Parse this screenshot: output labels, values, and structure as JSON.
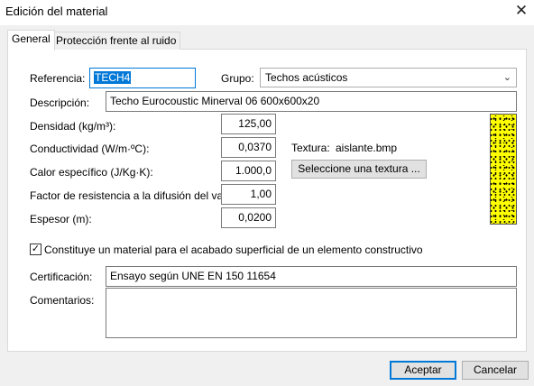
{
  "window": {
    "title": "Edición del material",
    "close_glyph": "✕"
  },
  "tabs": [
    {
      "label": "General",
      "active": true
    },
    {
      "label": "Protección frente al ruido",
      "active": false
    }
  ],
  "form": {
    "referencia": {
      "label": "Referencia:",
      "value": "TECH4"
    },
    "grupo": {
      "label": "Grupo:",
      "value": "Techos acústicos"
    },
    "descripcion": {
      "label": "Descripción:",
      "value": "Techo Eurocoustic Minerval 06 600x600x20"
    },
    "densidad": {
      "label": "Densidad (kg/m³):",
      "value": "125,00"
    },
    "conductividad": {
      "label": "Conductividad (W/m·ºC):",
      "value": "0,0370"
    },
    "calor": {
      "label": "Calor específico (J/Kg·K):",
      "value": "1.000,0"
    },
    "resistencia": {
      "label": "Factor de resistencia a la difusión del vapor:",
      "value": "1,00"
    },
    "espesor": {
      "label": "Espesor (m):",
      "value": "0,0200"
    },
    "textura": {
      "label": "Textura:",
      "value": "aislante.bmp",
      "button": "Seleccione una textura ...",
      "swatch_color": "#ffff00"
    },
    "acabado": {
      "label": "Constituye un material para el acabado superficial de un elemento constructivo",
      "checked": true,
      "check_glyph": "✓"
    },
    "certificacion": {
      "label": "Certificación:",
      "value": "Ensayo según UNE EN 150 11654"
    },
    "comentarios": {
      "label": "Comentarios:",
      "value": ""
    }
  },
  "footer": {
    "accept": "Aceptar",
    "cancel": "Cancelar"
  },
  "colors": {
    "accent": "#0078d7"
  }
}
